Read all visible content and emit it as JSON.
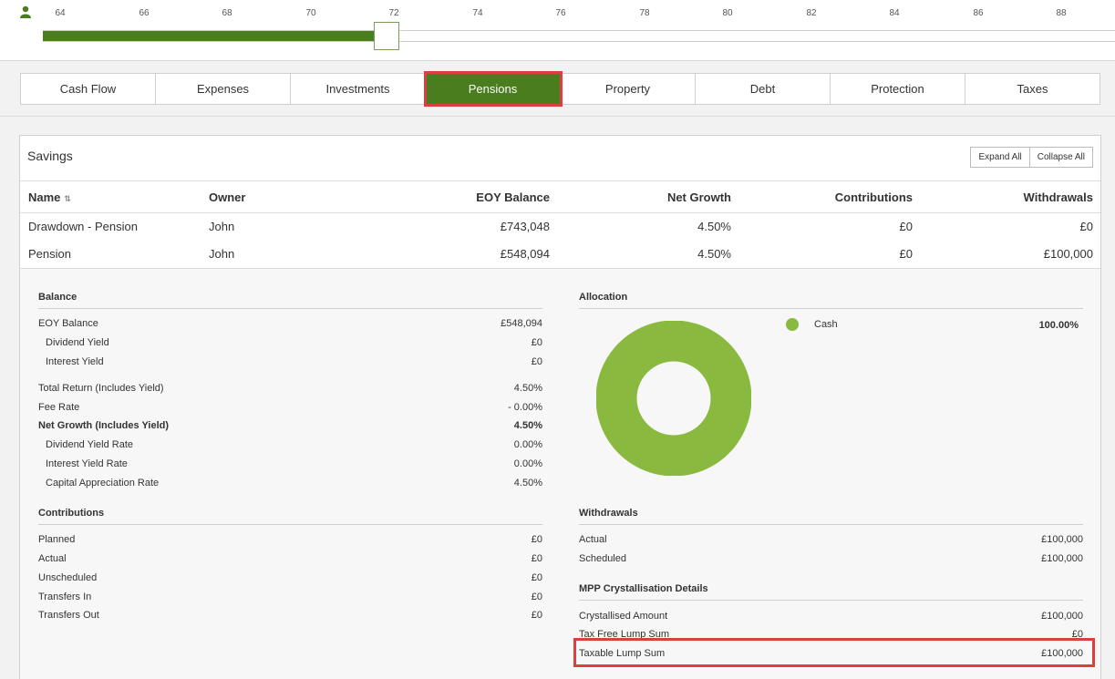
{
  "timeline": {
    "ticks": [
      "64",
      "66",
      "68",
      "70",
      "72",
      "74",
      "76",
      "78",
      "80",
      "82",
      "84",
      "86",
      "88"
    ],
    "selected_age": 72,
    "fill_color": "#4a7d1e"
  },
  "tabs": [
    {
      "label": "Cash Flow"
    },
    {
      "label": "Expenses"
    },
    {
      "label": "Investments"
    },
    {
      "label": "Pensions",
      "active": true
    },
    {
      "label": "Property"
    },
    {
      "label": "Debt"
    },
    {
      "label": "Protection"
    },
    {
      "label": "Taxes"
    }
  ],
  "savings": {
    "title": "Savings",
    "expand_all": "Expand All",
    "collapse_all": "Collapse All",
    "columns": {
      "name": "Name",
      "owner": "Owner",
      "eoy": "EOY Balance",
      "growth": "Net Growth",
      "contrib": "Contributions",
      "withdrawals": "Withdrawals"
    },
    "rows": [
      {
        "name": "Drawdown - Pension",
        "owner": "John",
        "eoy": "£743,048",
        "growth": "4.50%",
        "contrib": "£0",
        "withdrawals": "£0"
      },
      {
        "name": "Pension",
        "owner": "John",
        "eoy": "£548,094",
        "growth": "4.50%",
        "contrib": "£0",
        "withdrawals": "£100,000"
      }
    ]
  },
  "detail": {
    "balance": {
      "heading": "Balance",
      "items": [
        {
          "label": "EOY Balance",
          "value": "£548,094"
        },
        {
          "label": "Dividend Yield",
          "value": "£0"
        },
        {
          "label": "Interest Yield",
          "value": "£0"
        },
        {
          "label": "Total Return (Includes Yield)",
          "value": "4.50%"
        },
        {
          "label": "Fee Rate",
          "value": "- 0.00%"
        },
        {
          "label": "Net Growth (Includes Yield)",
          "value": "4.50%"
        },
        {
          "label": "Dividend Yield Rate",
          "value": "0.00%"
        },
        {
          "label": "Interest Yield Rate",
          "value": "0.00%"
        },
        {
          "label": "Capital Appreciation Rate",
          "value": "4.50%"
        }
      ]
    },
    "contributions": {
      "heading": "Contributions",
      "items": [
        {
          "label": "Planned",
          "value": "£0"
        },
        {
          "label": "Actual",
          "value": "£0"
        },
        {
          "label": "Unscheduled",
          "value": "£0"
        },
        {
          "label": "Transfers In",
          "value": "£0"
        },
        {
          "label": "Transfers Out",
          "value": "£0"
        }
      ]
    },
    "allocation": {
      "heading": "Allocation",
      "legend_label": "Cash",
      "legend_value": "100.00%",
      "color": "#8ab93f"
    },
    "withdrawals": {
      "heading": "Withdrawals",
      "items": [
        {
          "label": "Actual",
          "value": "£100,000"
        },
        {
          "label": "Scheduled",
          "value": "£100,000"
        }
      ]
    },
    "mpp": {
      "heading": "MPP Crystallisation Details",
      "items": [
        {
          "label": "Crystallised Amount",
          "value": "£100,000"
        },
        {
          "label": "Tax Free Lump Sum",
          "value": "£0"
        },
        {
          "label": "Taxable Lump Sum",
          "value": "£100,000"
        }
      ]
    }
  }
}
